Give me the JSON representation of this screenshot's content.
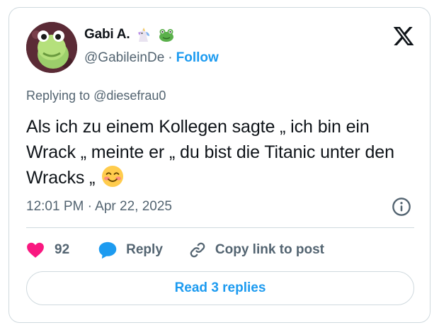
{
  "author": {
    "display_name": "Gabi A.",
    "handle": "@GabileinDe",
    "separator": "·",
    "follow_label": "Follow",
    "badges": [
      "unicorn-emoji",
      "frog-emoji"
    ]
  },
  "reply": {
    "prefix": "Replying to",
    "mention": "@diesefrau0"
  },
  "tweet": {
    "text": "Als ich zu einem Kollegen sagte „ ich bin ein Wrack „ meinte er „ du bist die Titanic unter den Wracks „",
    "trailing_emoji": "smiling-face-with-smiling-eyes"
  },
  "timestamp": "12:01 PM · Apr 22, 2025",
  "actions": {
    "like_count": "92",
    "reply_label": "Reply",
    "copy_label": "Copy link to post"
  },
  "read_replies_label": "Read 3 replies",
  "colors": {
    "accent": "#1d9bf0",
    "like": "#f91880",
    "muted": "#536471",
    "border": "#cfd9de"
  }
}
